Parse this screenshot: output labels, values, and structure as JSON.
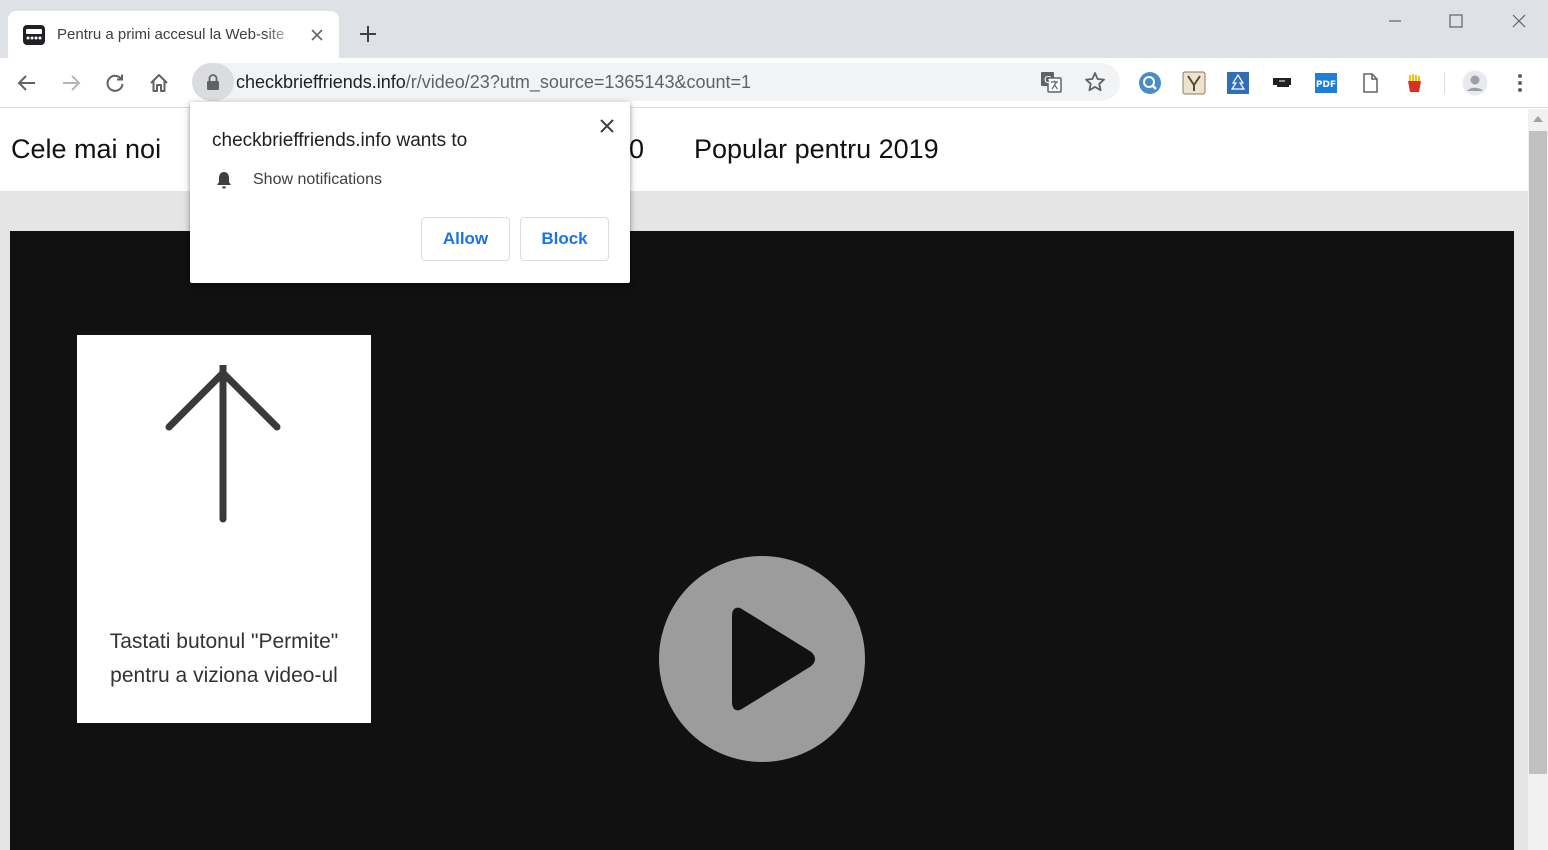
{
  "browser": {
    "tab": {
      "title": "Pentru a primi accesul la Web-site"
    },
    "url": {
      "host": "checkbrieffriends.info",
      "path": "/r/video/23?utm_source=1365143&count=1"
    },
    "extensions": [
      "search-extension",
      "yoast-extension",
      "tree-extension",
      "cast-extension",
      "pdf-extension",
      "page-extension",
      "fries-extension"
    ],
    "pdf_label": "PDF"
  },
  "site": {
    "nav": [
      "Cele mai noi",
      "0",
      "Popular pentru 2019"
    ],
    "instruction": {
      "line1": "Tastati butonul \"Permite\"",
      "line2": "pentru a viziona video-ul"
    }
  },
  "popup": {
    "title": "checkbrieffriends.info wants to",
    "permission": "Show notifications",
    "allow": "Allow",
    "block": "Block"
  },
  "colors": {
    "accent": "#1a73e8",
    "video_bg": "#111111",
    "play_circle": "#9c9c9c"
  }
}
